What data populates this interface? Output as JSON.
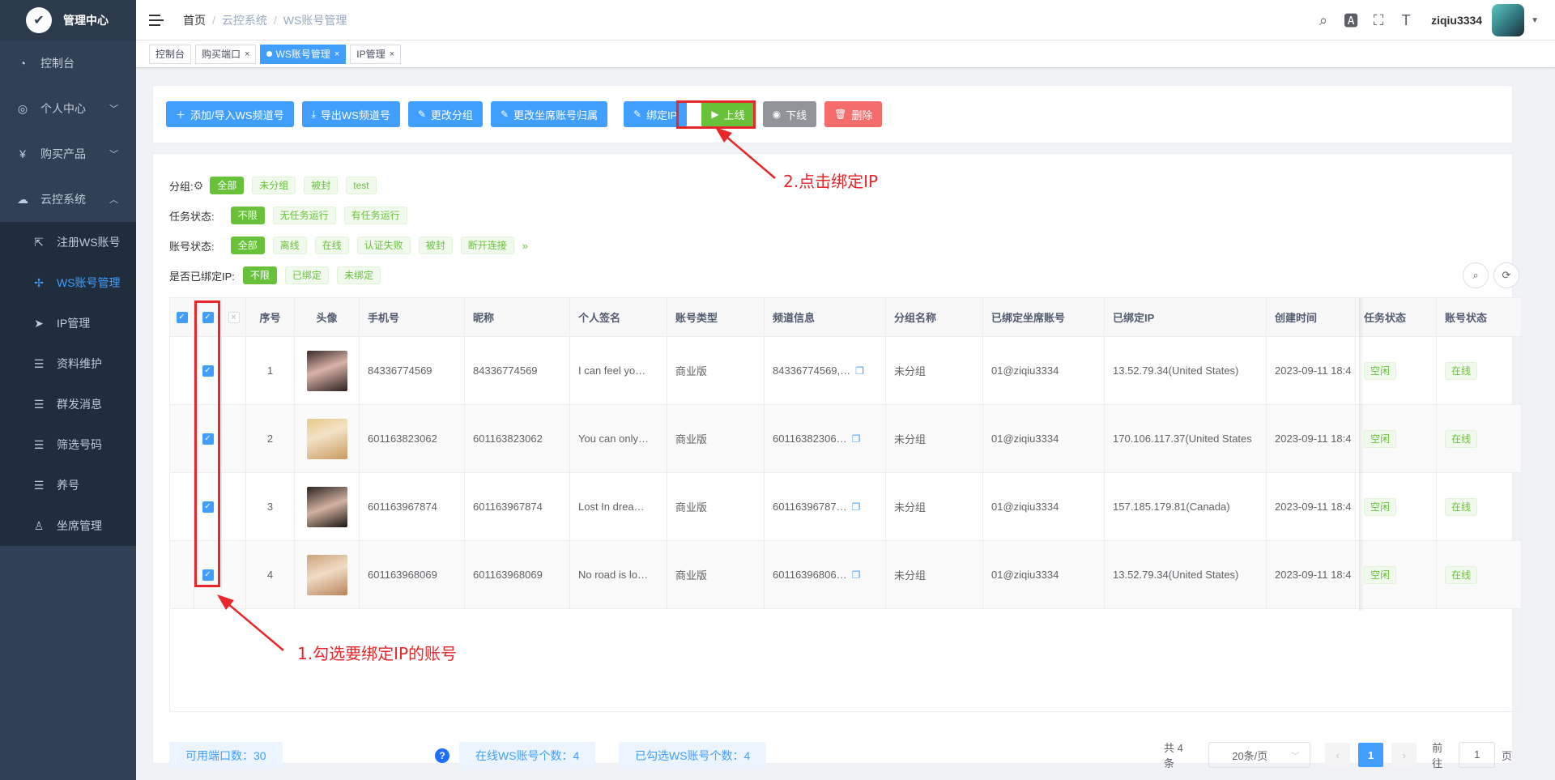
{
  "sidebar": {
    "logo_text": "管理中心",
    "items": [
      {
        "label": "控制台",
        "icon": "dashboard-icon"
      },
      {
        "label": "个人中心",
        "icon": "user-icon"
      },
      {
        "label": "购买产品",
        "icon": "yen-icon"
      },
      {
        "label": "云控系统",
        "icon": "cloud-icon"
      }
    ],
    "submenu": [
      {
        "label": "注册WS账号",
        "icon": "external-link-icon"
      },
      {
        "label": "WS账号管理",
        "icon": "move-icon"
      },
      {
        "label": "IP管理",
        "icon": "send-icon"
      },
      {
        "label": "资料维护",
        "icon": "list-icon"
      },
      {
        "label": "群发消息",
        "icon": "list-icon"
      },
      {
        "label": "筛选号码",
        "icon": "list-icon"
      },
      {
        "label": "养号",
        "icon": "list-icon"
      },
      {
        "label": "坐席管理",
        "icon": "person-icon"
      }
    ]
  },
  "breadcrumb": [
    "首页",
    "云控系统",
    "WS账号管理"
  ],
  "header": {
    "username": "ziqiu3334"
  },
  "tags": [
    {
      "label": "控制台",
      "closable": false,
      "active": false
    },
    {
      "label": "购买端口",
      "closable": true,
      "active": false
    },
    {
      "label": "WS账号管理",
      "closable": true,
      "active": true
    },
    {
      "label": "IP管理",
      "closable": true,
      "active": false
    }
  ],
  "toolbar": {
    "add": "添加/导入WS频道号",
    "export": "导出WS频道号",
    "change_group": "更改分组",
    "change_seat": "更改坐席账号归属",
    "bind_ip": "绑定IP",
    "online": "上线",
    "offline": "下线",
    "delete": "删除"
  },
  "filters": {
    "group": {
      "label": "分组:",
      "options": [
        "全部",
        "未分组",
        "被封",
        "test"
      ]
    },
    "task": {
      "label": "任务状态:",
      "options": [
        "不限",
        "无任务运行",
        "有任务运行"
      ]
    },
    "account": {
      "label": "账号状态:",
      "options": [
        "全部",
        "离线",
        "在线",
        "认证失败",
        "被封",
        "断开连接"
      ]
    },
    "bound": {
      "label": "是否已绑定IP:",
      "options": [
        "不限",
        "已绑定",
        "未绑定"
      ]
    }
  },
  "table": {
    "headers": [
      "序号",
      "头像",
      "手机号",
      "昵称",
      "个人签名",
      "账号类型",
      "频道信息",
      "分组名称",
      "已绑定坐席账号",
      "已绑定IP",
      "创建时间",
      "任务状态",
      "账号状态"
    ],
    "rows": [
      {
        "no": "1",
        "phone": "84336774569",
        "nick": "84336774569",
        "sign": "I can feel yo…",
        "type": "商业版",
        "channel": "84336774569,…",
        "group": "未分组",
        "seat": "01@ziqiu3334",
        "ip": "13.52.79.34(United States)",
        "created": "2023-09-11 18:4",
        "task": "空闲",
        "status": "在线"
      },
      {
        "no": "2",
        "phone": "601163823062",
        "nick": "601163823062",
        "sign": "You can only…",
        "type": "商业版",
        "channel": "60116382306…",
        "group": "未分组",
        "seat": "01@ziqiu3334",
        "ip": "170.106.117.37(United States",
        "created": "2023-09-11 18:4",
        "task": "空闲",
        "status": "在线"
      },
      {
        "no": "3",
        "phone": "601163967874",
        "nick": "601163967874",
        "sign": "Lost In drea…",
        "type": "商业版",
        "channel": "60116396787…",
        "group": "未分组",
        "seat": "01@ziqiu3334",
        "ip": "157.185.179.81(Canada)",
        "created": "2023-09-11 18:4",
        "task": "空闲",
        "status": "在线"
      },
      {
        "no": "4",
        "phone": "601163968069",
        "nick": "601163968069",
        "sign": "No road is lo…",
        "type": "商业版",
        "channel": "60116396806…",
        "group": "未分组",
        "seat": "01@ziqiu3334",
        "ip": "13.52.79.34(United States)",
        "created": "2023-09-11 18:4",
        "task": "空闲",
        "status": "在线"
      }
    ]
  },
  "footer": {
    "ports": "可用端口数：30",
    "online": "在线WS账号个数：4",
    "selected": "已勾选WS账号个数：4",
    "total": "共 4 条",
    "page_size": "20条/页",
    "current_page": "1",
    "goto_label": "前往",
    "goto_value": "1",
    "page_unit": "页"
  },
  "annotations": {
    "step1": "1.勾选要绑定IP的账号",
    "step2": "2.点击绑定IP"
  },
  "colors": {
    "primary": "#409eff",
    "success": "#67c23a",
    "danger": "#f56c6c",
    "info": "#909399",
    "annotation": "#e8272b",
    "sidebar": "#304156"
  }
}
